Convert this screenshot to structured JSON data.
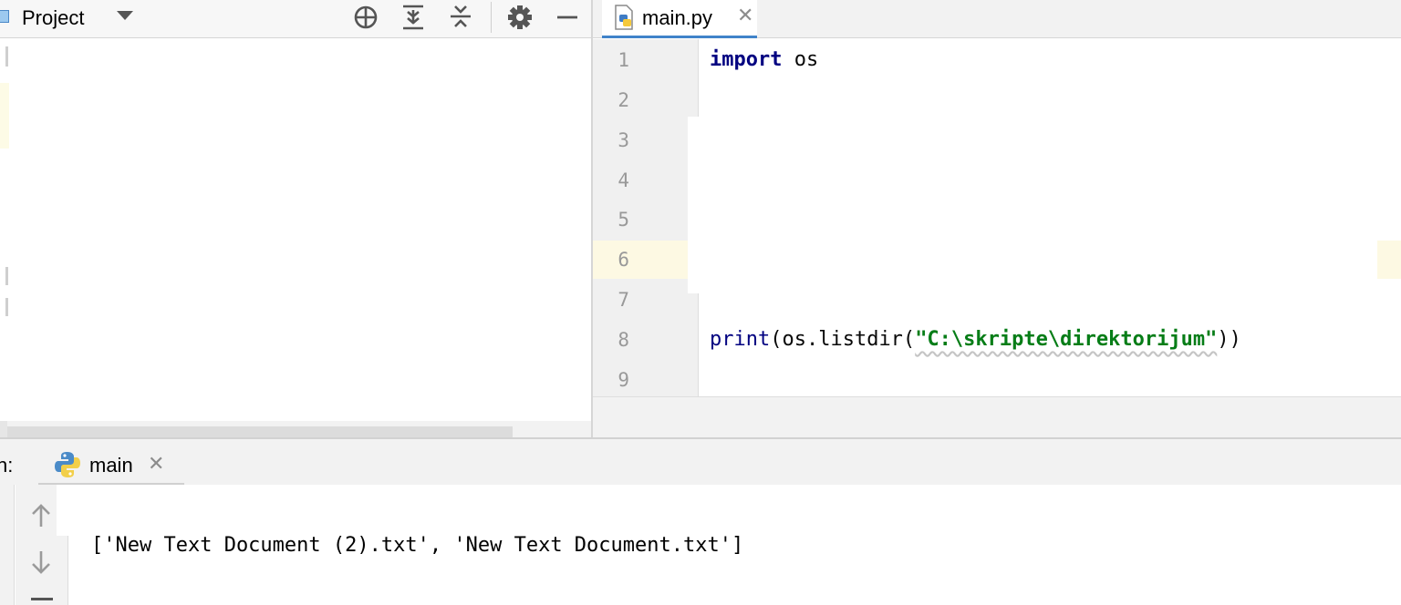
{
  "project_panel": {
    "title": "Project",
    "icons": [
      "project-icon",
      "dropdown-arrow-icon",
      "locate-icon",
      "expand-all-icon",
      "collapse-all-icon",
      "gear-icon",
      "minimize-icon"
    ]
  },
  "editor": {
    "tab": {
      "label": "main.py",
      "icon": "python-file-icon",
      "close": "✕"
    },
    "line_numbers": [
      "1",
      "2",
      "3",
      "4",
      "5",
      "6",
      "7",
      "8",
      "9"
    ],
    "current_line": 6,
    "code": {
      "line1_keyword": "import",
      "line1_rest": " os",
      "line8_func": "print",
      "line8_mid": "(os.listdir(",
      "line8_string": "\"C:\\skripte\\direktorijum\"",
      "line8_end": "))"
    }
  },
  "run_panel": {
    "label": "n:",
    "tab": {
      "label": "main",
      "icon": "python-icon",
      "close": "✕"
    },
    "output": "['New Text Document (2).txt', 'New Text Document.txt']",
    "toolbar_icons": [
      "arrow-up-icon",
      "arrow-down-icon",
      "minus-icon"
    ]
  }
}
